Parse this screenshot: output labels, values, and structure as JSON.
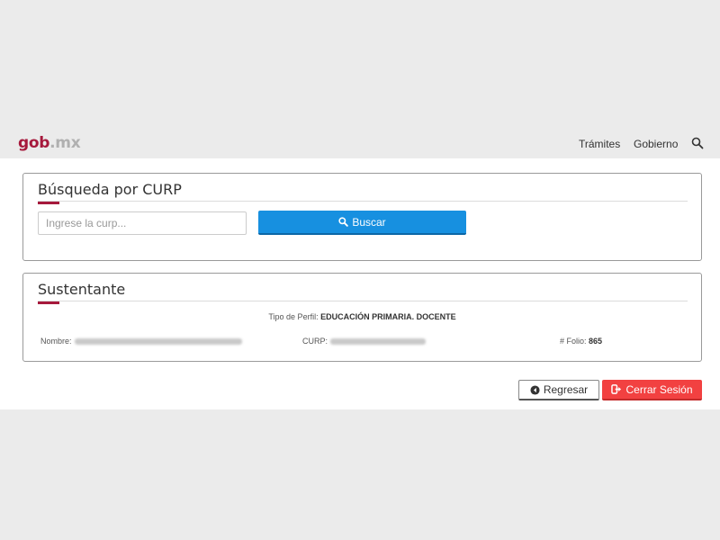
{
  "header": {
    "brand_gob": "gob",
    "brand_mx": ".mx",
    "nav": {
      "tramites": "Trámites",
      "gobierno": "Gobierno"
    },
    "search_icon": "search-icon"
  },
  "busqueda": {
    "title": "Búsqueda por CURP",
    "input_placeholder": "Ingrese la curp...",
    "input_value": "",
    "button_label": "Buscar",
    "button_icon": "search-icon"
  },
  "sustentante": {
    "title": "Sustentante",
    "tipo_perfil_label": "Tipo de Perfil:",
    "tipo_perfil_value": "EDUCACIÓN PRIMARIA. DOCENTE",
    "nombre_label": "Nombre:",
    "curp_label": "CURP:",
    "folio_label": "# Folio:",
    "folio_value": "865"
  },
  "actions": {
    "regresar_label": "Regresar",
    "regresar_icon": "arrow-left-circle-icon",
    "cerrar_label": "Cerrar Sesión",
    "cerrar_icon": "sign-out-icon"
  },
  "colors": {
    "brand_red": "#a6193c",
    "primary_blue": "#1790e0",
    "danger_red": "#f24141",
    "background_gray": "#ebebeb"
  }
}
